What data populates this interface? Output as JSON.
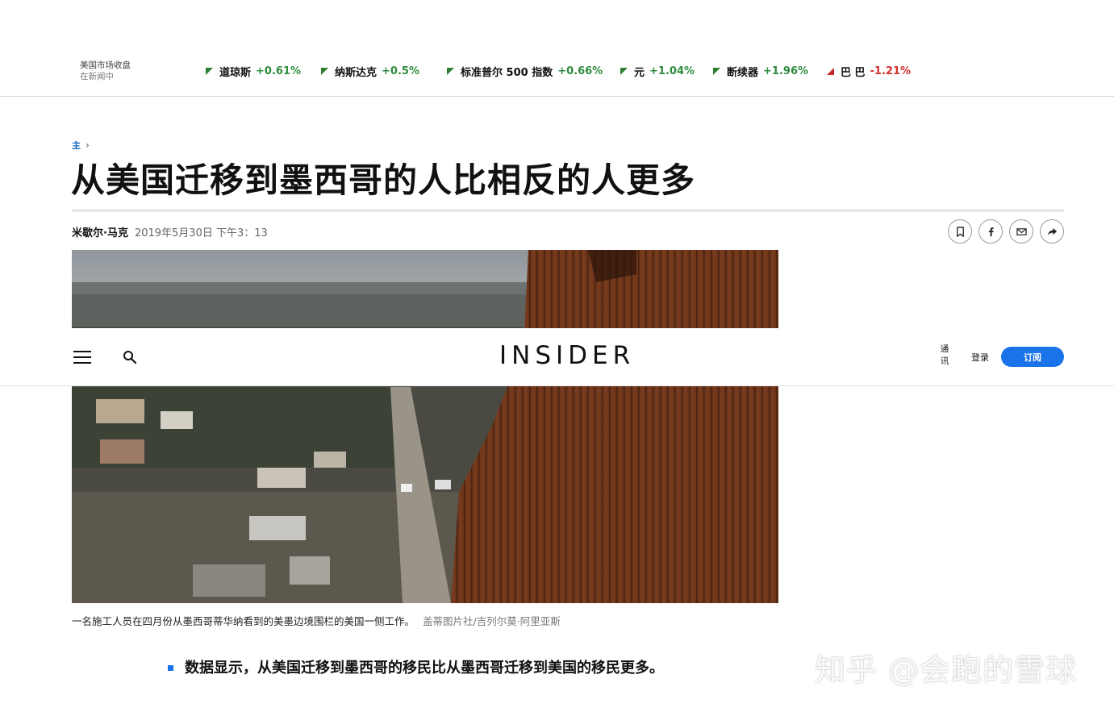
{
  "ticker": {
    "label_line1": "美国市场收盘",
    "label_line2": "在新闻中",
    "items": [
      {
        "name": "道琼斯",
        "change": "+0.61%",
        "direction": "up"
      },
      {
        "name": "纳斯达克",
        "change": "+0.5%",
        "direction": "up"
      },
      {
        "name": "标准普尔 500 指数",
        "change": "+0.66%",
        "direction": "up"
      },
      {
        "name": "元",
        "change": "+1.04%",
        "direction": "up"
      },
      {
        "name": "断续器",
        "change": "+1.96%",
        "direction": "up"
      },
      {
        "name": "巴 巴",
        "change": "-1.21%",
        "direction": "down"
      }
    ],
    "colors": {
      "up": "#2e8b3e",
      "down": "#d32f2f"
    }
  },
  "nav": {
    "logo": "INSIDER",
    "newsletter": "通讯",
    "login": "登录",
    "subscribe": "订阅",
    "accent": "#1a73e8"
  },
  "article": {
    "breadcrumb": "主",
    "headline": "从美国迁移到墨西哥的人比相反的人更多",
    "author": "米歇尔·马克",
    "date": "2019年5月30日 下午3：13",
    "share_icons": [
      "bookmark-icon",
      "facebook-icon",
      "email-icon",
      "share-icon"
    ],
    "caption": "一名施工人员在四月份从墨西哥蒂华纳看到的美墨边境围栏的美国一侧工作。",
    "credit": "盖蒂图片社/吉列尔莫·阿里亚斯",
    "bullet": "数据显示，从美国迁移到墨西哥的移民比从墨西哥迁移到美国的移民更多。"
  },
  "watermark": "知乎 @会跑的雪球"
}
